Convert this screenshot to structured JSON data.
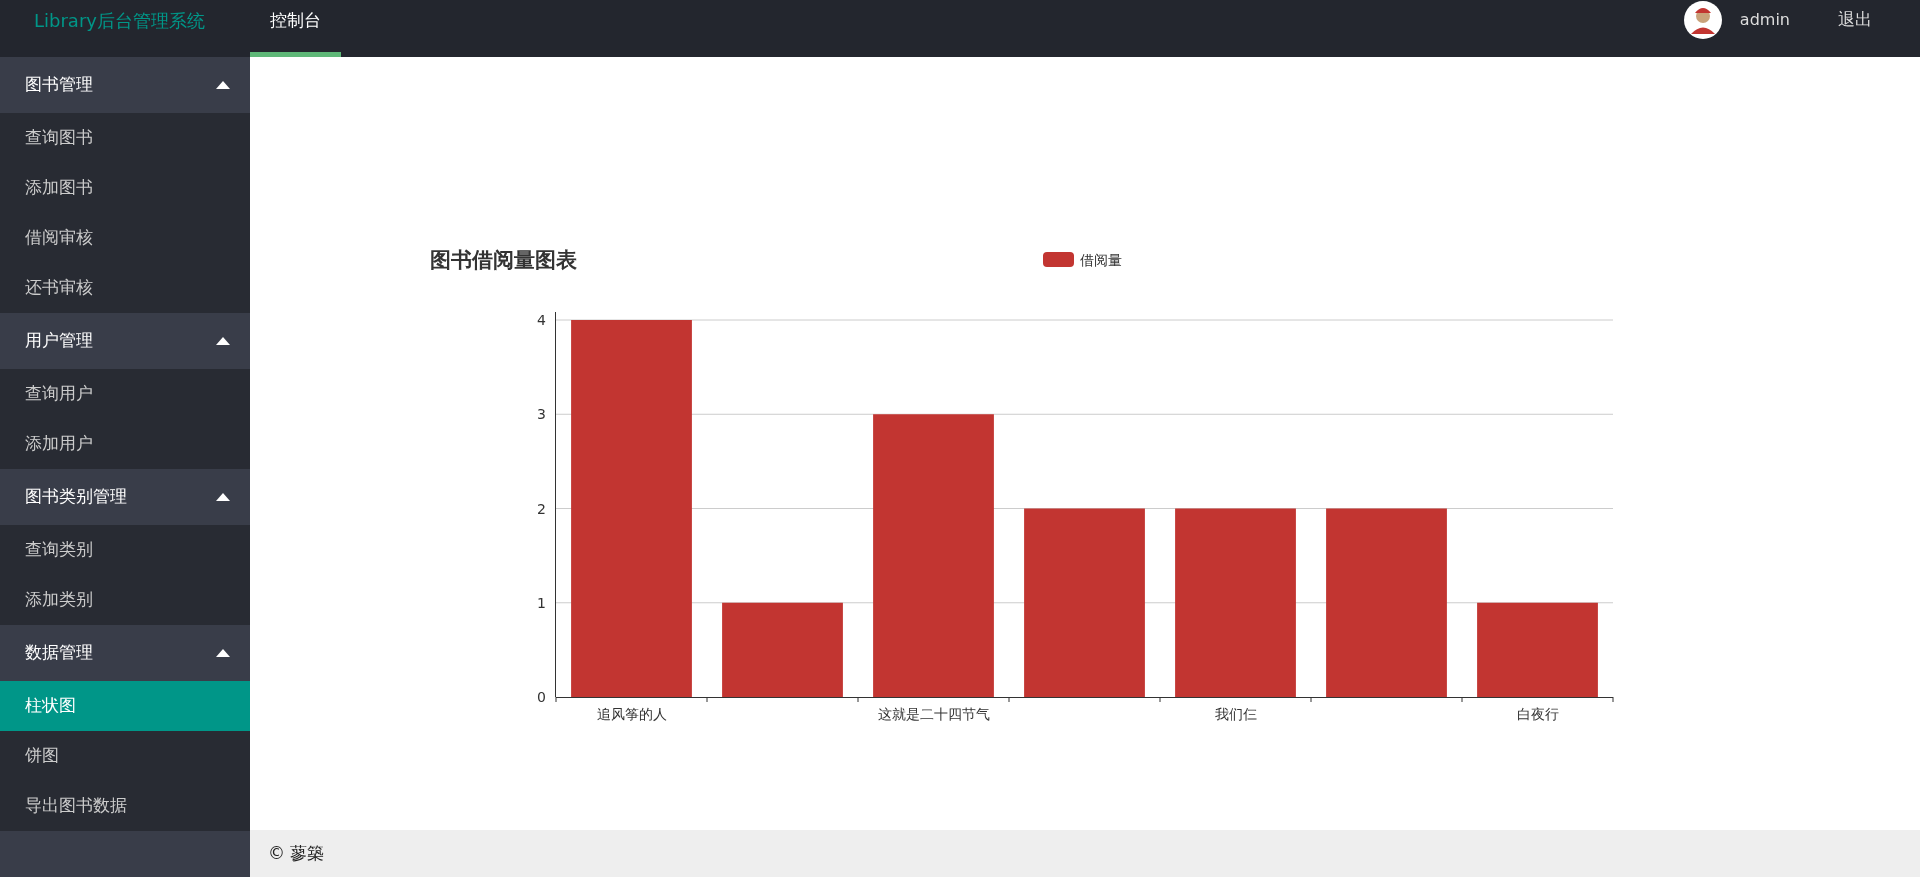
{
  "header": {
    "brand": "Library后台管理系统",
    "tabs": [
      {
        "label": "控制台",
        "selected": true
      }
    ],
    "user": {
      "name": "admin"
    },
    "logout": "退出"
  },
  "sidebar": {
    "groups": [
      {
        "label": "图书管理",
        "expanded": true,
        "items": [
          {
            "label": "查询图书",
            "selected": false
          },
          {
            "label": "添加图书",
            "selected": false
          },
          {
            "label": "借阅审核",
            "selected": false
          },
          {
            "label": "还书审核",
            "selected": false
          }
        ]
      },
      {
        "label": "用户管理",
        "expanded": true,
        "items": [
          {
            "label": "查询用户",
            "selected": false
          },
          {
            "label": "添加用户",
            "selected": false
          }
        ]
      },
      {
        "label": "图书类别管理",
        "expanded": true,
        "items": [
          {
            "label": "查询类别",
            "selected": false
          },
          {
            "label": "添加类别",
            "selected": false
          }
        ]
      },
      {
        "label": "数据管理",
        "expanded": true,
        "items": [
          {
            "label": "柱状图",
            "selected": true
          },
          {
            "label": "饼图",
            "selected": false
          },
          {
            "label": "导出图书数据",
            "selected": false
          }
        ]
      }
    ]
  },
  "main": {
    "chart_data": {
      "type": "bar",
      "title": "图书借阅量图表",
      "categories": [
        "追风筝的人",
        null,
        "这就是二十四节气",
        null,
        "我们仨",
        null,
        "白夜行"
      ],
      "series": [
        {
          "name": "借阅量",
          "color": "#c23531",
          "values": [
            4,
            1,
            3,
            2,
            2,
            2,
            1
          ]
        }
      ],
      "grid": true,
      "ylim": [
        0,
        4
      ],
      "yticks": [
        0,
        1,
        2,
        3,
        4
      ]
    }
  },
  "footer": {
    "text": "© 蓼築"
  }
}
